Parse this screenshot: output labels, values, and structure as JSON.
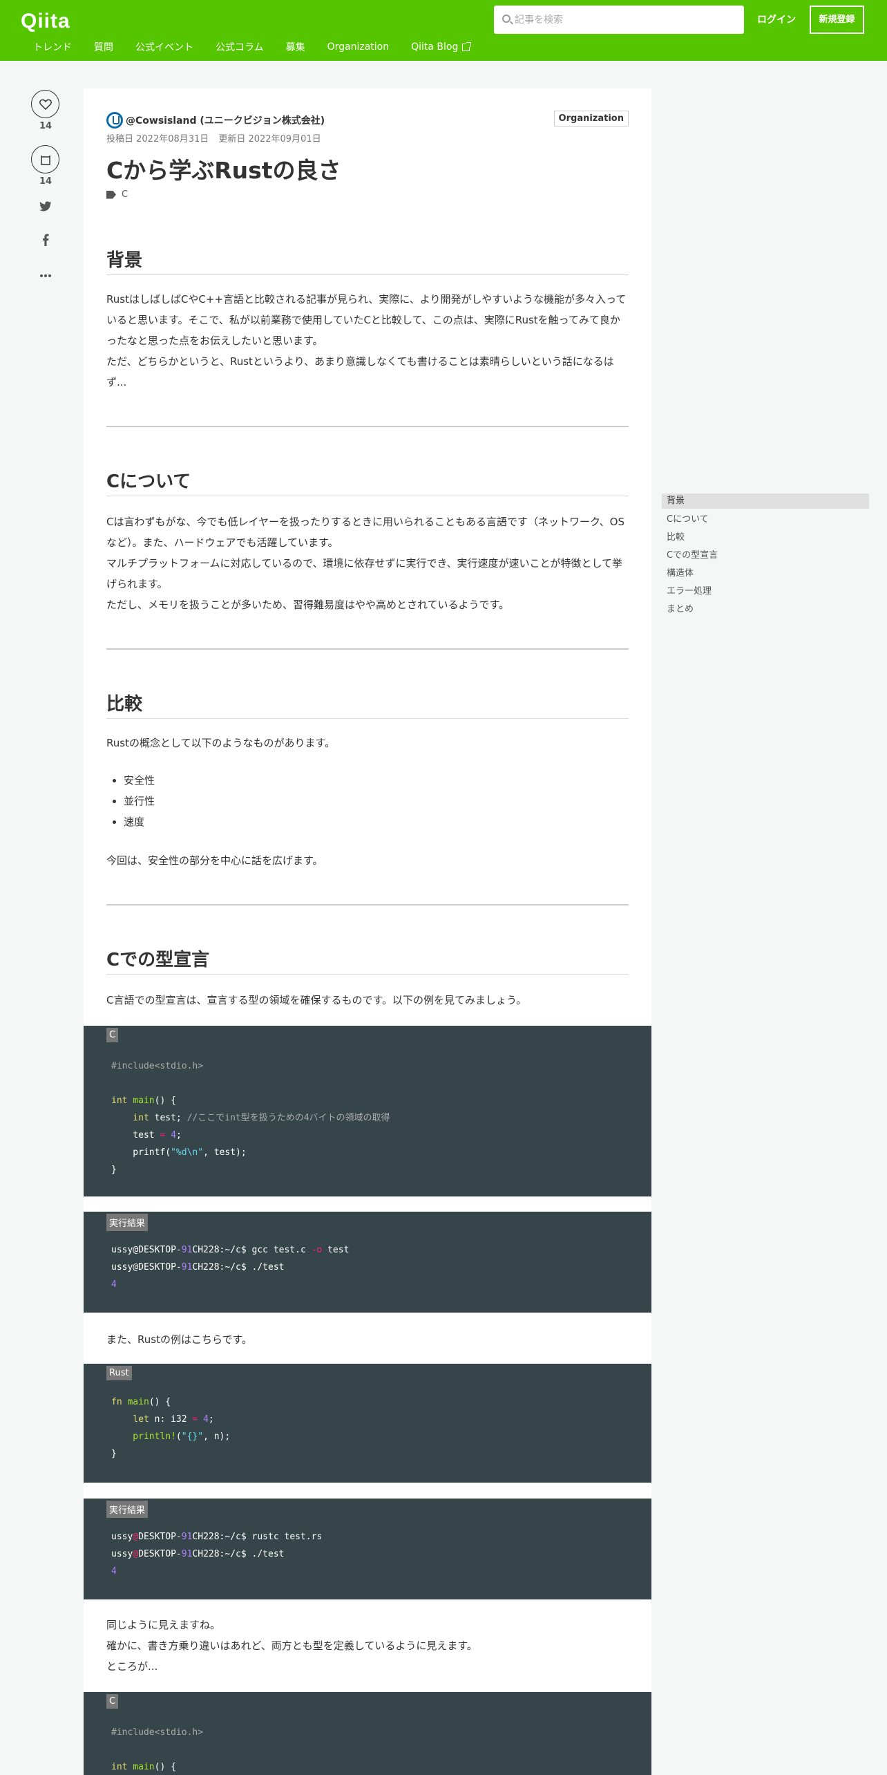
{
  "header": {
    "logo": "Qiita",
    "search_placeholder": "記事を検索",
    "login": "ログイン",
    "signup": "新規登録",
    "nav": [
      "トレンド",
      "質問",
      "公式イベント",
      "公式コラム",
      "募集",
      "Organization",
      "Qiita Blog"
    ]
  },
  "actions": {
    "like_count": "14",
    "stock_count": "14"
  },
  "article": {
    "author": "@Cowsisland (ユニークビジョン株式会社)",
    "org_badge": "Organization",
    "posted": "投稿日 2022年08月31日",
    "updated": "更新日 2022年09月01日",
    "title": "Cから学ぶRustの良さ",
    "tag": "C",
    "sections": {
      "bg": {
        "heading": "背景",
        "p1": "RustはしばしばCやC++言語と比較される記事が見られ、実際に、より開発がしやすいような機能が多々入っていると思います。そこで、私が以前業務で使用していたCと比較して、この点は、実際にRustを触ってみて良かったなと思った点をお伝えしたいと思います。",
        "p2": "ただ、どちらかというと、Rustというより、あまり意識しなくても書けることは素晴らしいという話になるはず..."
      },
      "c": {
        "heading": "Cについて",
        "p1": "Cは言わずもがな、今でも低レイヤーを扱ったりするときに用いられることもある言語です（ネットワーク、OSなど）。また、ハードウェアでも活躍しています。",
        "p2": "マルチプラットフォームに対応しているので、環境に依存せずに実行でき、実行速度が速いことが特徴として挙げられます。",
        "p3": "ただし、メモリを扱うことが多いため、習得難易度はやや高めとされているようです。"
      },
      "cmp": {
        "heading": "比較",
        "p1": "Rustの概念として以下のようなものがあります。",
        "items": [
          "安全性",
          "並行性",
          "速度"
        ],
        "p2": "今回は、安全性の部分を中心に話を広げます。"
      },
      "decl": {
        "heading": "Cでの型宣言",
        "p1": "C言語での型宣言は、宣言する型の領域を確保するものです。以下の例を見てみましょう。",
        "p2": "また、Rustの例はこちらです。",
        "p3a": "同じように見えますね。",
        "p3b": "確かに、書き方乗り違いはあれど、両方とも型を定義しているように見えます。",
        "p3c": "ところが..."
      }
    },
    "code_labels": {
      "c": "C",
      "result": "実行結果",
      "rust": "Rust"
    },
    "code1": {
      "l1": "#include<stdio.h>",
      "int": "int",
      "main": "main",
      "l3rest": "() {",
      "l4a": "    int",
      "l4b": " test; ",
      "l4c": "//ここでint型を扱うための4バイトの領域の取得",
      "l5a": "    test ",
      "l5b": "=",
      "l5c": " ",
      "l5d": "4",
      "l5e": ";",
      "l6a": "    printf(",
      "l6b": "\"%d\\n\"",
      "l6c": ", test);",
      "l7": "}"
    },
    "result1": {
      "user": "ussy@DESKTOP-",
      "n91": "91",
      "host": "CH228:",
      "path": "~/c$ ",
      "cmd1": "gcc test.c ",
      "opt": "-o",
      "cmd1b": " test",
      "cmd2": "./test",
      "out": "4"
    },
    "code2": {
      "fn": "fn",
      "main": "main",
      "l1rest": "() {",
      "l2a": "    let",
      "l2b": " n: i32 ",
      "l2c": "=",
      "l2d": " ",
      "l2e": "4",
      "l2f": ";",
      "l3a": "    println!",
      "l3b": "(",
      "l3c": "\"{}\"",
      "l3d": ", n);",
      "l4": "}"
    },
    "result2": {
      "u": "ussy",
      "at": "@",
      "desk": "DESKTOP-",
      "n91": "91",
      "host": "CH228:",
      "path": "~/c$ ",
      "cmd1": "rustc test.rs",
      "cmd2": "./test",
      "out": "4"
    },
    "code3": {
      "l1": "#include<stdio.h>",
      "int": "int",
      "main": "main",
      "rest": "() {"
    }
  },
  "toc": [
    "背景",
    "Cについて",
    "比較",
    "Cでの型宣言",
    "構造体",
    "エラー処理",
    "まとめ"
  ],
  "colors": {
    "brand": "#55c500",
    "code_bg": "#364549"
  }
}
